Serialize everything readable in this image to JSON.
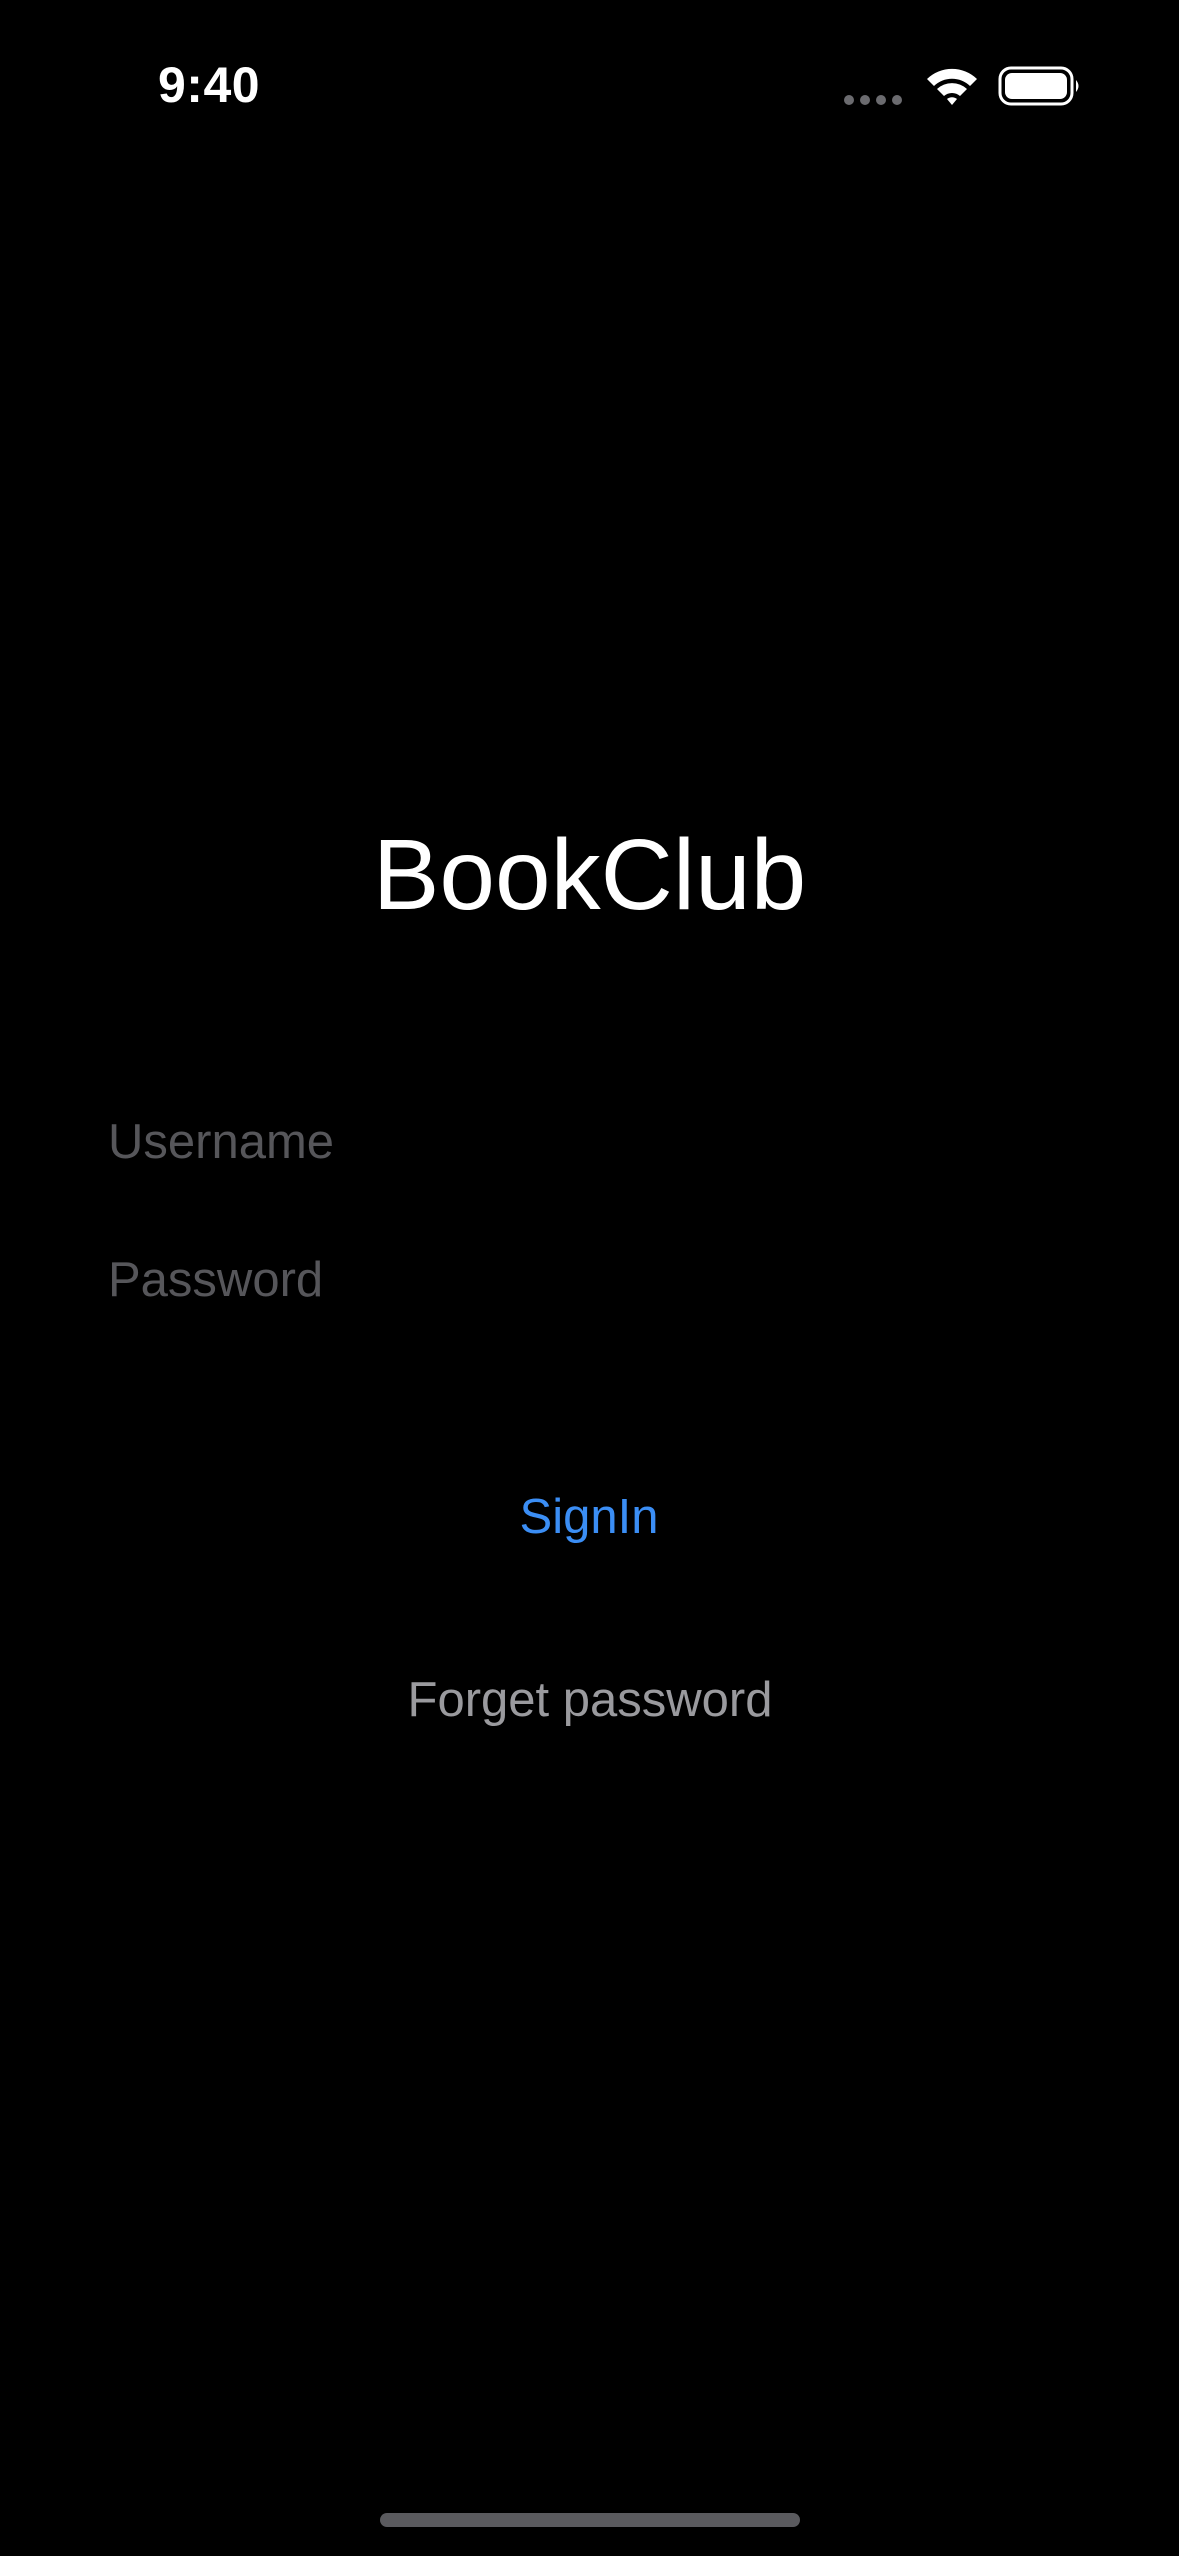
{
  "status_bar": {
    "time": "9:40",
    "signal_icon": "cellular-signal-dots-icon",
    "wifi_icon": "wifi-icon",
    "battery_icon": "battery-full-icon"
  },
  "app": {
    "title": "BookClub"
  },
  "form": {
    "username_placeholder": "Username",
    "username_value": "",
    "password_placeholder": "Password",
    "password_value": "",
    "signin_label": "SignIn",
    "forget_password_label": "Forget password"
  },
  "colors": {
    "background": "#000000",
    "accent": "#3b8ef5",
    "placeholder": "#56565a",
    "secondary_text": "#9a9a9e"
  }
}
